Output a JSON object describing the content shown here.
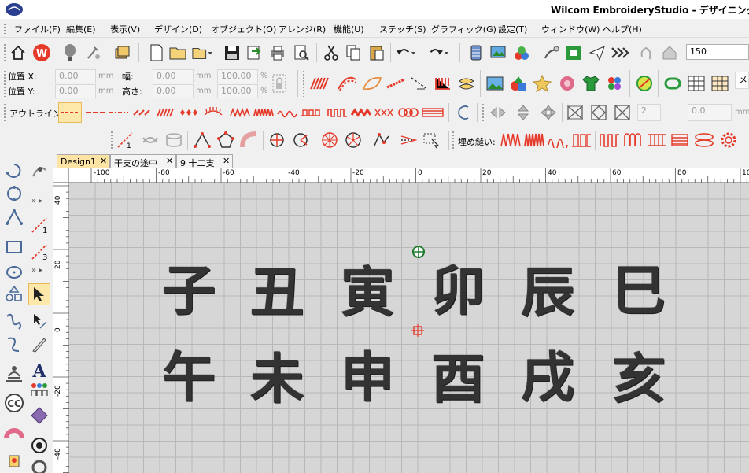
{
  "window": {
    "title": "Wilcom EmbroideryStudio - デザイニング"
  },
  "menu": [
    "ファイル(F)",
    "編集(E)",
    "表示(V)",
    "デザイン(D)",
    "オブジェクト(O)",
    "アレンジ(R)",
    "機能(U)",
    "ステッチ(S)",
    "グラフィック(G)",
    "設定(T)",
    "ウィンドウ(W)",
    "ヘルプ(H)"
  ],
  "toolbar": {
    "zoom_value": "150"
  },
  "props": {
    "pos_x_label": "位置 X:",
    "pos_y_label": "位置 Y:",
    "width_label": "幅:",
    "height_label": "高さ:",
    "pos_x": "0.00",
    "pos_y": "0.00",
    "width": "0.00",
    "height": "0.00",
    "scale_w": "100.00",
    "scale_h": "100.00",
    "unit_mm": "mm",
    "unit_pct": "%",
    "outline_label": "アウトライン:",
    "fill_label": "埋め縫い:",
    "count_value": "2",
    "spacing_value": "0.0",
    "method_label": "メ"
  },
  "tabs": [
    {
      "label": "Design1",
      "active": true
    },
    {
      "label": "干支の途中",
      "active": false
    },
    {
      "label": "9 十二支",
      "active": false
    }
  ],
  "ruler_h": [
    "-100",
    "-80",
    "-60",
    "-40",
    "-20",
    "0",
    "20",
    "40",
    "60",
    "80",
    "10"
  ],
  "ruler_v": [
    "40",
    "20",
    "0",
    "-20",
    "-40"
  ],
  "design": {
    "row1": [
      "子",
      "丑",
      "寅",
      "卯",
      "辰",
      "巳"
    ],
    "row2": [
      "午",
      "未",
      "申",
      "酉",
      "戌",
      "亥"
    ]
  },
  "colors": {
    "accent_red": "#e53a2a",
    "active_tab": "#fde3a4",
    "stitch": "#333333"
  }
}
